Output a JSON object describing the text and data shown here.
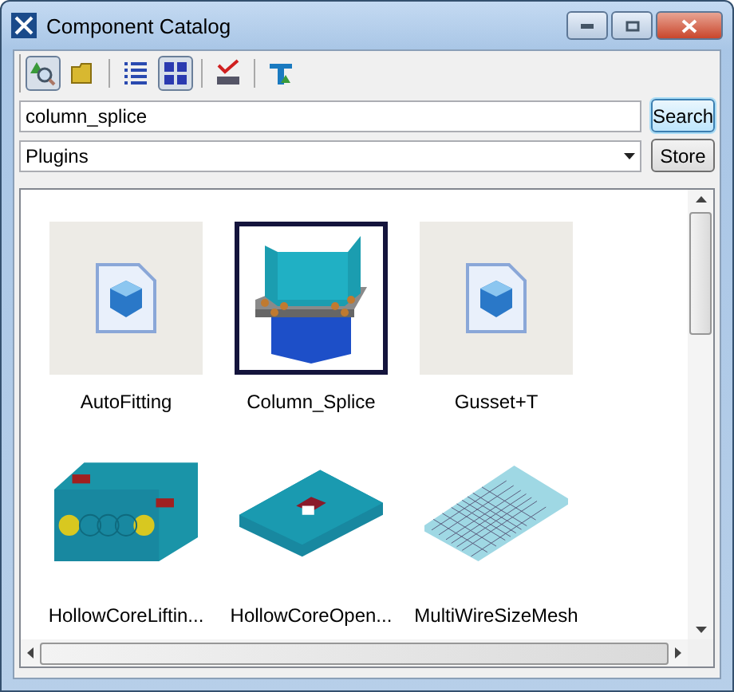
{
  "window": {
    "title": "Component Catalog"
  },
  "toolbar": [
    {
      "kind": "search-tree",
      "selected": true
    },
    {
      "kind": "folder",
      "selected": false
    },
    {
      "kind": "sep"
    },
    {
      "kind": "list",
      "selected": false
    },
    {
      "kind": "thumbnails",
      "selected": true
    },
    {
      "kind": "sep"
    },
    {
      "kind": "spellcheck",
      "selected": false
    },
    {
      "kind": "sep"
    },
    {
      "kind": "filter",
      "selected": false
    }
  ],
  "search": {
    "value": "column_splice",
    "button": "Search"
  },
  "group": {
    "value": "Plugins",
    "button": "Store"
  },
  "items": [
    {
      "name": "AutoFitting",
      "kind": "file",
      "selected": false
    },
    {
      "name": "Column_Splice",
      "kind": "splice",
      "selected": true
    },
    {
      "name": "Gusset+T",
      "kind": "file",
      "selected": false
    },
    {
      "name": "HollowCoreLiftin...",
      "kind": "hollowcore",
      "selected": false
    },
    {
      "name": "HollowCoreOpen...",
      "kind": "opening",
      "selected": false
    },
    {
      "name": "MultiWireSizeMesh",
      "kind": "mesh",
      "selected": false
    }
  ]
}
